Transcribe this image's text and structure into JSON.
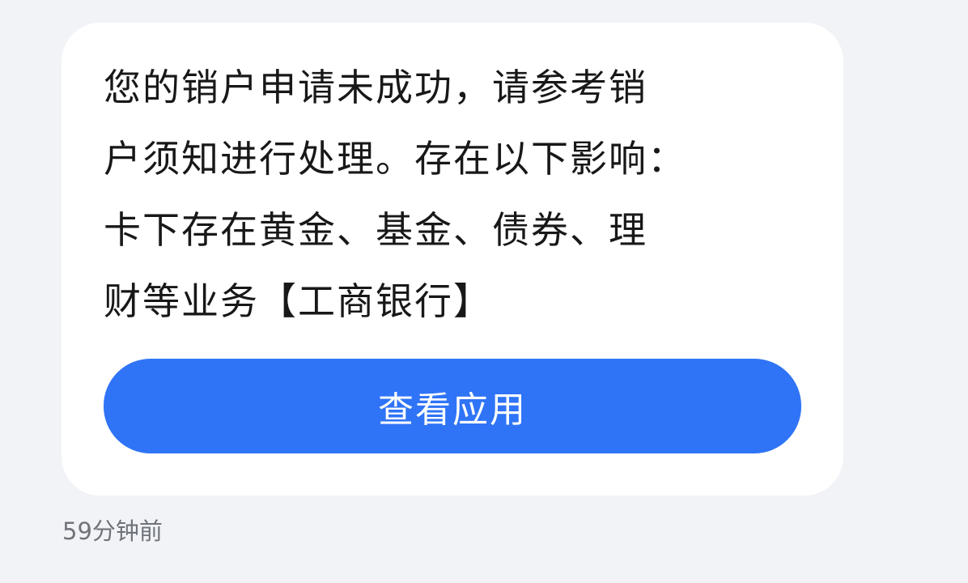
{
  "notification": {
    "message_lines": [
      "您的销户申请未成功，请参考销",
      "户须知进行处理。存在以下影响：",
      "卡下存在黄金、基金、债券、理",
      "财等业务【工商银行】"
    ],
    "button_label": "查看应用",
    "timestamp": "59分钟前"
  }
}
